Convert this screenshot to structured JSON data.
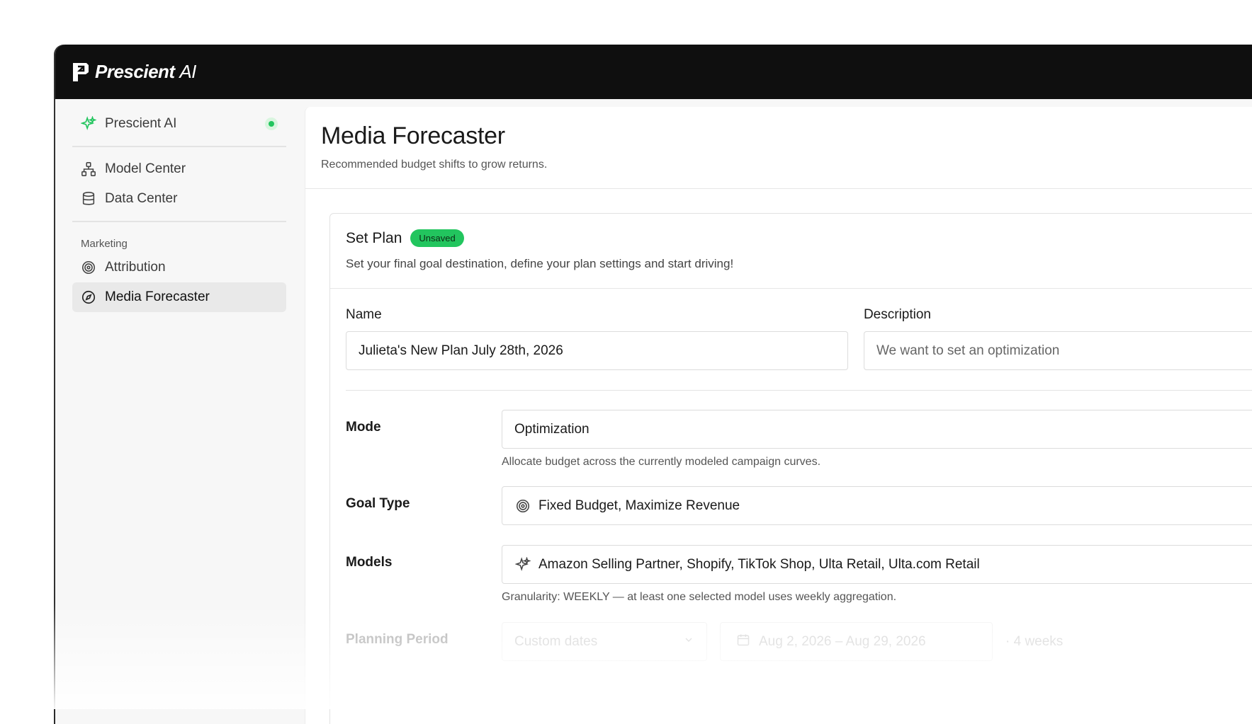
{
  "brand": {
    "name": "Prescient",
    "suffix": "AI"
  },
  "sidebar": {
    "top_item": {
      "label": "Prescient AI",
      "icon": "sparkle-icon",
      "status": "online"
    },
    "items": [
      {
        "label": "Model Center",
        "icon": "model-tree-icon"
      },
      {
        "label": "Data Center",
        "icon": "database-icon"
      }
    ],
    "section_label": "Marketing",
    "marketing_items": [
      {
        "label": "Attribution",
        "icon": "target-icon"
      },
      {
        "label": "Media Forecaster",
        "icon": "compass-icon",
        "active": true
      }
    ]
  },
  "page": {
    "title": "Media Forecaster",
    "subtitle": "Recommended budget shifts to grow returns."
  },
  "card": {
    "title": "Set Plan",
    "badge": "Unsaved",
    "subtitle": "Set your final goal destination, define your plan settings and start driving!",
    "name": {
      "label": "Name",
      "value": "Julieta's New Plan July 28th, 2026"
    },
    "description": {
      "label": "Description",
      "value": "We want to set an optimization"
    },
    "mode": {
      "label": "Mode",
      "value": "Optimization",
      "hint": "Allocate budget across the currently modeled campaign curves."
    },
    "goal_type": {
      "label": "Goal Type",
      "value": "Fixed Budget, Maximize Revenue",
      "icon": "target-icon"
    },
    "models": {
      "label": "Models",
      "value": "Amazon Selling Partner, Shopify, TikTok Shop, Ulta Retail, Ulta.com Retail",
      "icon": "sparkle-icon",
      "hint": "Granularity: WEEKLY — at least one selected model uses weekly aggregation."
    },
    "planning_period": {
      "label": "Planning Period",
      "preset": "Custom dates",
      "date_range": "Aug 2, 2026 – Aug 29, 2026",
      "duration": "· 4 weeks"
    }
  },
  "colors": {
    "accent_green": "#22c55e",
    "topbar": "#0f0f0f"
  }
}
